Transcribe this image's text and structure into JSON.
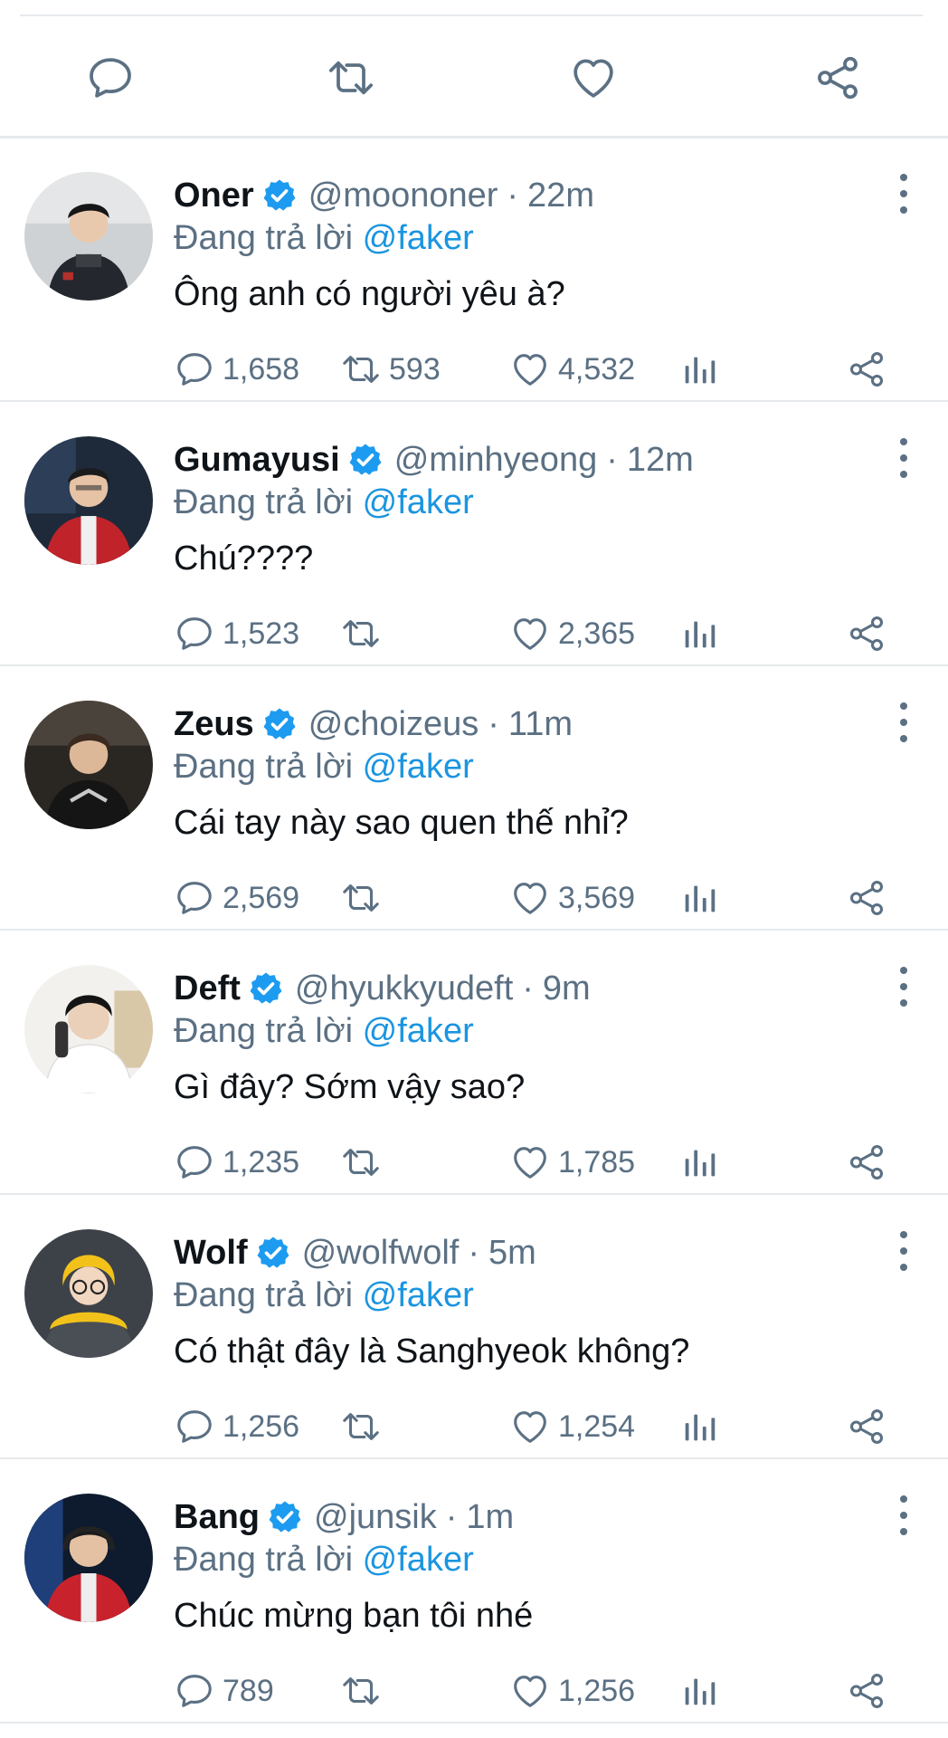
{
  "top_actions": [
    {
      "icon": "reply-icon"
    },
    {
      "icon": "retweet-icon"
    },
    {
      "icon": "like-icon"
    },
    {
      "icon": "share-icon"
    }
  ],
  "reply_prefix": "Đang trả lời",
  "reply_target": "@faker",
  "colors": {
    "accent": "#1b95e0",
    "muted": "#5b7083",
    "text": "#0f1419",
    "divider": "#e6e9ec"
  },
  "tweets": [
    {
      "name": "Oner",
      "handle": "@moononer",
      "separator": "·",
      "time": "22m",
      "text": "Ông anh có người yêu à?",
      "replies": "1,658",
      "retweets": "593",
      "likes": "4,532"
    },
    {
      "name": "Gumayusi",
      "handle": "@minhyeong",
      "separator": "·",
      "time": "12m",
      "text": "Chú????",
      "replies": "1,523",
      "retweets": "",
      "likes": "2,365"
    },
    {
      "name": "Zeus",
      "handle": "@choizeus",
      "separator": "·",
      "time": "11m",
      "text": "Cái tay này sao quen thế nhỉ?",
      "replies": "2,569",
      "retweets": "",
      "likes": "3,569"
    },
    {
      "name": "Deft",
      "handle": "@hyukkyudeft",
      "separator": "·",
      "time": "9m",
      "text": "Gì đây? Sớm vậy sao?",
      "replies": "1,235",
      "retweets": "",
      "likes": "1,785"
    },
    {
      "name": "Wolf",
      "handle": "@wolfwolf",
      "separator": "·",
      "time": "5m",
      "text": "Có thật đây là Sanghyeok không?",
      "replies": "1,256",
      "retweets": "",
      "likes": "1,254"
    },
    {
      "name": "Bang",
      "handle": "@junsik",
      "separator": "·",
      "time": "1m",
      "text": "Chúc mừng bạn tôi nhé",
      "replies": "789",
      "retweets": "",
      "likes": "1,256"
    }
  ]
}
